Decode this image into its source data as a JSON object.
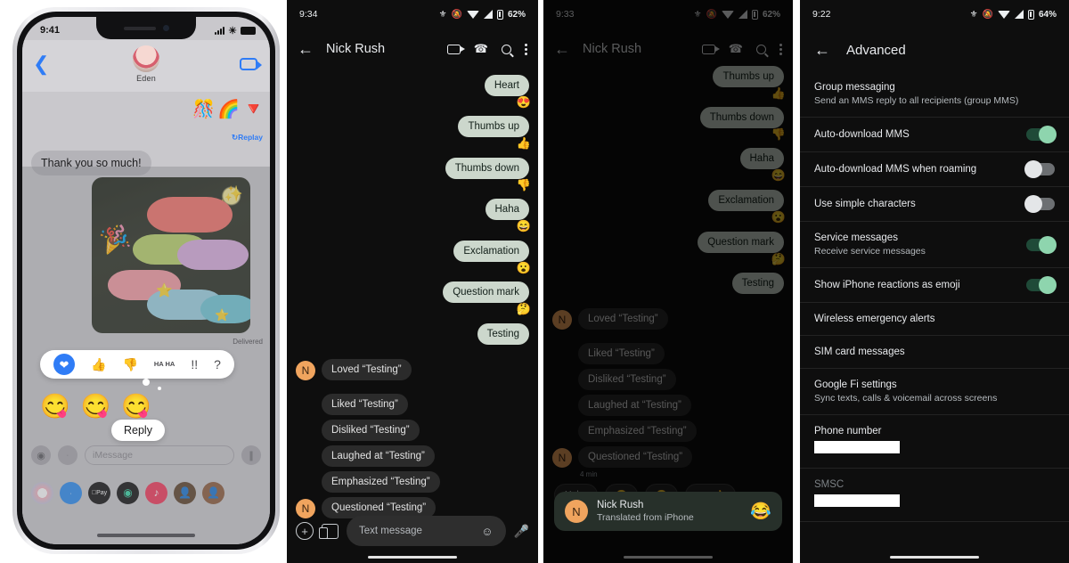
{
  "panels": {
    "iphone": {
      "status": {
        "time": "9:41"
      },
      "header": {
        "contact": "Eden",
        "back_icon": "chevron-left-icon",
        "video_icon": "video-camera-icon"
      },
      "thread": {
        "effects": [
          "🎊",
          "🌈",
          "🔻"
        ],
        "replay_label": "Replay",
        "incoming_message": "Thank you so much!",
        "delivered_label": "Delivered",
        "photo_alt": "macarons"
      },
      "tapback": {
        "options": [
          "heart",
          "thumbs-up",
          "thumbs-down",
          "HA HA",
          "!!",
          "?"
        ],
        "selected": "heart"
      },
      "stickers": [
        "😋",
        "😋",
        "😋"
      ],
      "reply_label": "Reply",
      "composer": {
        "placeholder": "iMessage",
        "camera_icon": "camera-icon",
        "apps_icon": "app-store-icon",
        "audio_icon": "audio-wave-icon"
      },
      "app_drawer": [
        "photos",
        "app-store",
        "apple-pay",
        "fitness",
        "music",
        "memoji-1",
        "memoji-2"
      ]
    },
    "reactions": {
      "status": {
        "time": "9:34",
        "battery": "62%"
      },
      "appbar": {
        "title": "Nick Rush",
        "back_icon": "arrow-left-icon",
        "video_icon": "video-camera-icon",
        "call_icon": "phone-icon",
        "search_icon": "search-icon",
        "more_icon": "overflow-menu-icon"
      },
      "outgoing": [
        {
          "text": "Heart",
          "reaction": "😍"
        },
        {
          "text": "Thumbs up",
          "reaction": "👍"
        },
        {
          "text": "Thumbs down",
          "reaction": "👎"
        },
        {
          "text": "Haha",
          "reaction": "😄"
        },
        {
          "text": "Exclamation",
          "reaction": "😮"
        },
        {
          "text": "Question mark",
          "reaction": "🤔"
        },
        {
          "text": "Testing",
          "reaction": ""
        }
      ],
      "incoming": [
        {
          "text": "Loved “Testing”",
          "avatar": "N"
        },
        {
          "text": "Liked “Testing”",
          "avatar": ""
        },
        {
          "text": "Disliked “Testing”",
          "avatar": ""
        },
        {
          "text": "Laughed at “Testing”",
          "avatar": ""
        },
        {
          "text": "Emphasized “Testing”",
          "avatar": ""
        },
        {
          "text": "Questioned “Testing”",
          "avatar": "N"
        }
      ],
      "composer": {
        "placeholder": "Text message",
        "add_icon": "plus-circle-icon",
        "gallery_icon": "gallery-icon",
        "emoji_icon": "emoji-icon",
        "mic_icon": "microphone-icon"
      }
    },
    "toast": {
      "status": {
        "time": "9:33",
        "battery": "62%"
      },
      "appbar": {
        "title": "Nick Rush"
      },
      "outgoing": [
        {
          "text": "Thumbs up",
          "reaction": "👍"
        },
        {
          "text": "Thumbs down",
          "reaction": "👎"
        },
        {
          "text": "Haha",
          "reaction": "😄"
        },
        {
          "text": "Exclamation",
          "reaction": "😮"
        },
        {
          "text": "Question mark",
          "reaction": "🤔"
        },
        {
          "text": "Testing",
          "reaction": ""
        }
      ],
      "incoming": [
        {
          "text": "Loved “Testing”",
          "avatar": "N"
        },
        {
          "text": "Liked “Testing”",
          "avatar": ""
        },
        {
          "text": "Disliked “Testing”",
          "avatar": ""
        },
        {
          "text": "Laughed at “Testing”",
          "avatar": ""
        },
        {
          "text": "Emphasized “Testing”",
          "avatar": ""
        },
        {
          "text": "Questioned “Testing”",
          "avatar": "N"
        }
      ],
      "timestamp": "4 min",
      "suggestion_chips": [
        "Haha",
        "😑",
        "😐",
        "Yes 👍"
      ],
      "notification": {
        "avatar": "N",
        "title": "Nick Rush",
        "subtitle": "Translated from iPhone",
        "emoji": "😂"
      }
    },
    "advanced": {
      "status": {
        "time": "9:22",
        "battery": "64%"
      },
      "appbar": {
        "title": "Advanced",
        "back_icon": "arrow-left-icon"
      },
      "rows": [
        {
          "label": "Group messaging",
          "sub": "Send an MMS reply to all recipients (group MMS)",
          "toggle": null
        },
        {
          "label": "Auto-download MMS",
          "sub": "",
          "toggle": "on"
        },
        {
          "label": "Auto-download MMS when roaming",
          "sub": "",
          "toggle": "off"
        },
        {
          "label": "Use simple characters",
          "sub": "",
          "toggle": "off"
        },
        {
          "label": "Service messages",
          "sub": "Receive service messages",
          "toggle": "on"
        },
        {
          "label": "Show iPhone reactions as emoji",
          "sub": "",
          "toggle": "on"
        },
        {
          "label": "Wireless emergency alerts",
          "sub": "",
          "toggle": null
        },
        {
          "label": "SIM card messages",
          "sub": "",
          "toggle": null
        },
        {
          "label": "Google Fi settings",
          "sub": "Sync texts, calls & voicemail across screens",
          "toggle": null
        }
      ],
      "fields": [
        {
          "label": "Phone number",
          "value": ""
        },
        {
          "label": "SMSC",
          "value": ""
        }
      ]
    }
  },
  "colors": {
    "android_bg": "#0e0e0e",
    "sent_bubble": "#ccd7cc",
    "received_bubble": "#2b2b2b",
    "avatar": "#f0a45e",
    "toggle_on": "#8ed5ae",
    "ios_accent": "#2f7cf6"
  }
}
